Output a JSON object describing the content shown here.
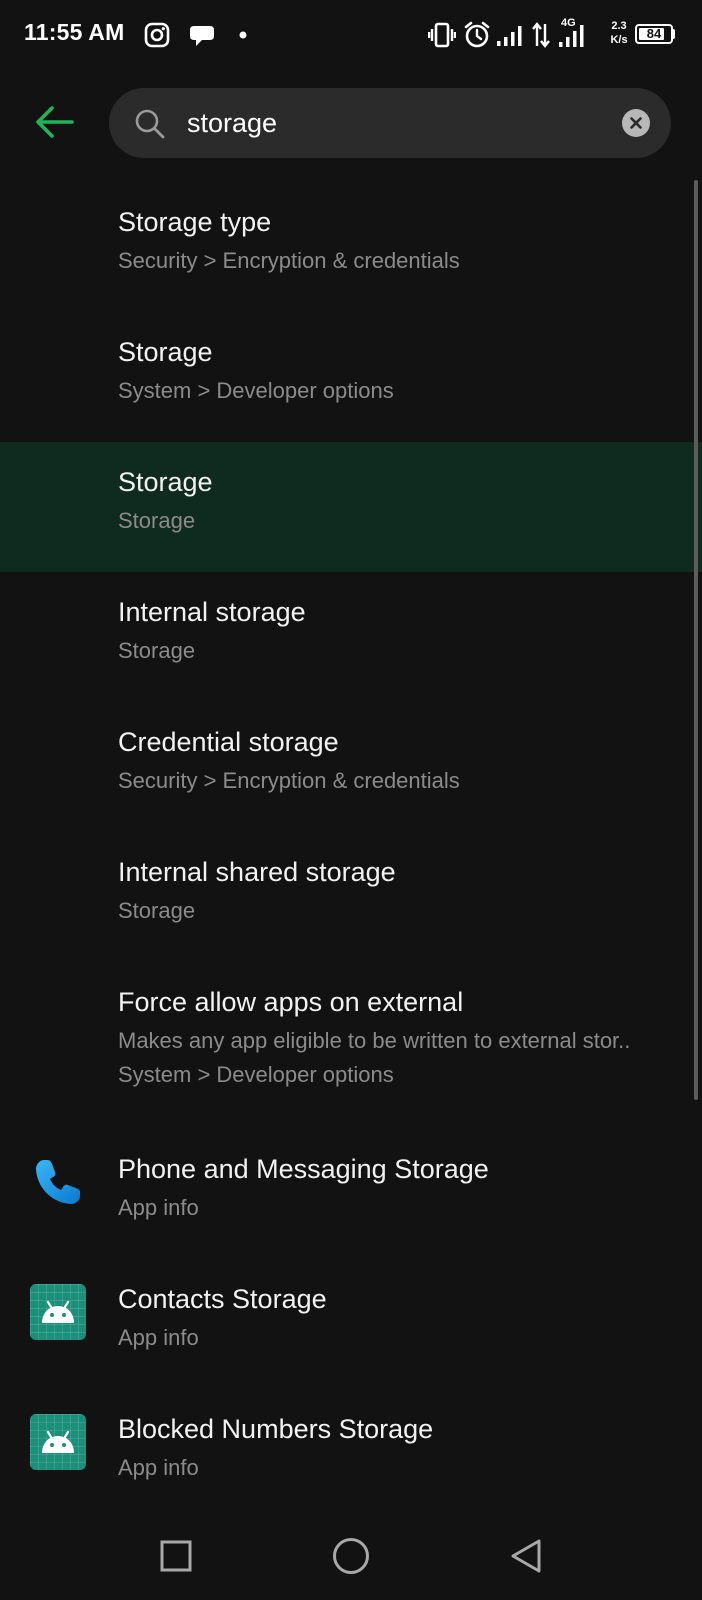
{
  "status_bar": {
    "time": "11:55 AM",
    "network_type": "4G",
    "speed_value": "2.3",
    "speed_unit": "K/s",
    "battery_level": "84",
    "icons": [
      "instagram-icon",
      "chat-bubble-icon",
      "notification-dot-icon",
      "vibrate-icon",
      "alarm-icon",
      "signal-icon",
      "data-transfer-icon",
      "signal-icon",
      "battery-icon"
    ]
  },
  "header": {
    "back_icon": "arrow-left-icon",
    "accent_color": "#21b35a",
    "search": {
      "value": "storage",
      "icon": "search-icon",
      "clear_icon": "clear-icon"
    }
  },
  "results": [
    {
      "title": "Storage type",
      "subtitle": "Security > Encryption & credentials"
    },
    {
      "title": "Storage",
      "subtitle": "System > Developer options"
    },
    {
      "title": "Storage",
      "subtitle": "Storage",
      "highlighted": true
    },
    {
      "title": "Internal storage",
      "subtitle": "Storage"
    },
    {
      "title": "Credential storage",
      "subtitle": "Security > Encryption & credentials"
    },
    {
      "title": "Internal shared storage",
      "subtitle": "Storage"
    },
    {
      "title": "Force allow apps on external",
      "summary": "Makes any app eligible to be written to external stor..",
      "subtitle": "System > Developer options"
    },
    {
      "title": "Phone and Messaging Storage",
      "subtitle": "App info",
      "icon": "phone-icon"
    },
    {
      "title": "Contacts Storage",
      "subtitle": "App info",
      "icon": "android-app-icon"
    },
    {
      "title": "Blocked Numbers Storage",
      "subtitle": "App info",
      "icon": "android-app-icon"
    }
  ],
  "nav_bar": {
    "recents_icon": "square-recents-icon",
    "home_icon": "circle-home-icon",
    "back_icon": "triangle-back-icon"
  },
  "colors": {
    "background": "#121212",
    "highlight": "#0f2a1f",
    "search_box": "#2b2b2b",
    "subtitle": "#8b8b8b"
  }
}
